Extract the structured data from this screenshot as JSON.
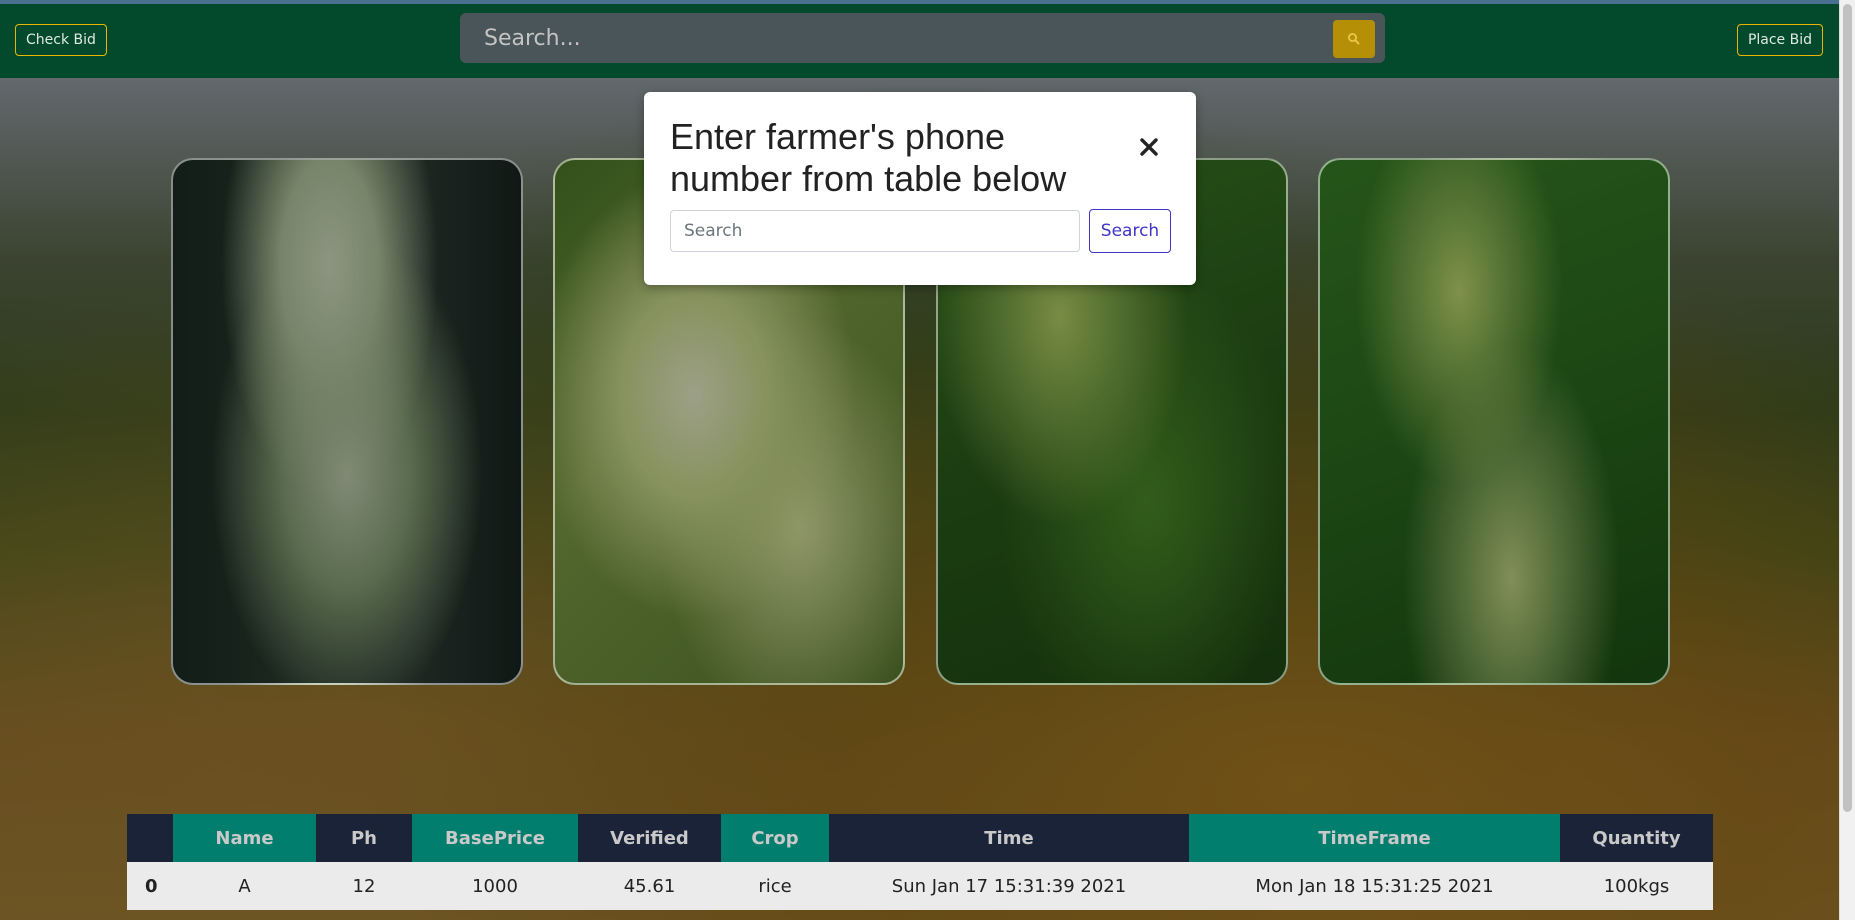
{
  "navbar": {
    "check_bid_label": "Check Bid",
    "search_placeholder": "Search...",
    "place_bid_label": "Place Bid"
  },
  "modal": {
    "title": "Enter farmer's phone number from table below",
    "input_placeholder": "Search",
    "search_button_label": "Search",
    "close_icon": "close-icon"
  },
  "cards": [
    {
      "name": "rice-flower-image"
    },
    {
      "name": "rice-grain-image"
    },
    {
      "name": "rice-plant-image"
    },
    {
      "name": "rice-field-image"
    }
  ],
  "table": {
    "headers": [
      "",
      "Name",
      "Ph",
      "BasePrice",
      "Verified",
      "Crop",
      "Time",
      "TimeFrame",
      "Quantity"
    ],
    "rows": [
      [
        "0",
        "A",
        "12",
        "1000",
        "45.61",
        "rice",
        "Sun Jan 17 15:31:39 2021",
        "Mon Jan 18 15:31:25 2021",
        "100kgs"
      ]
    ]
  },
  "colors": {
    "navbar": "#034a2d",
    "accent": "#b59007",
    "table_header_dark": "#1a2338",
    "table_header_teal": "#027e6e",
    "modal_button": "#3f35c8"
  }
}
